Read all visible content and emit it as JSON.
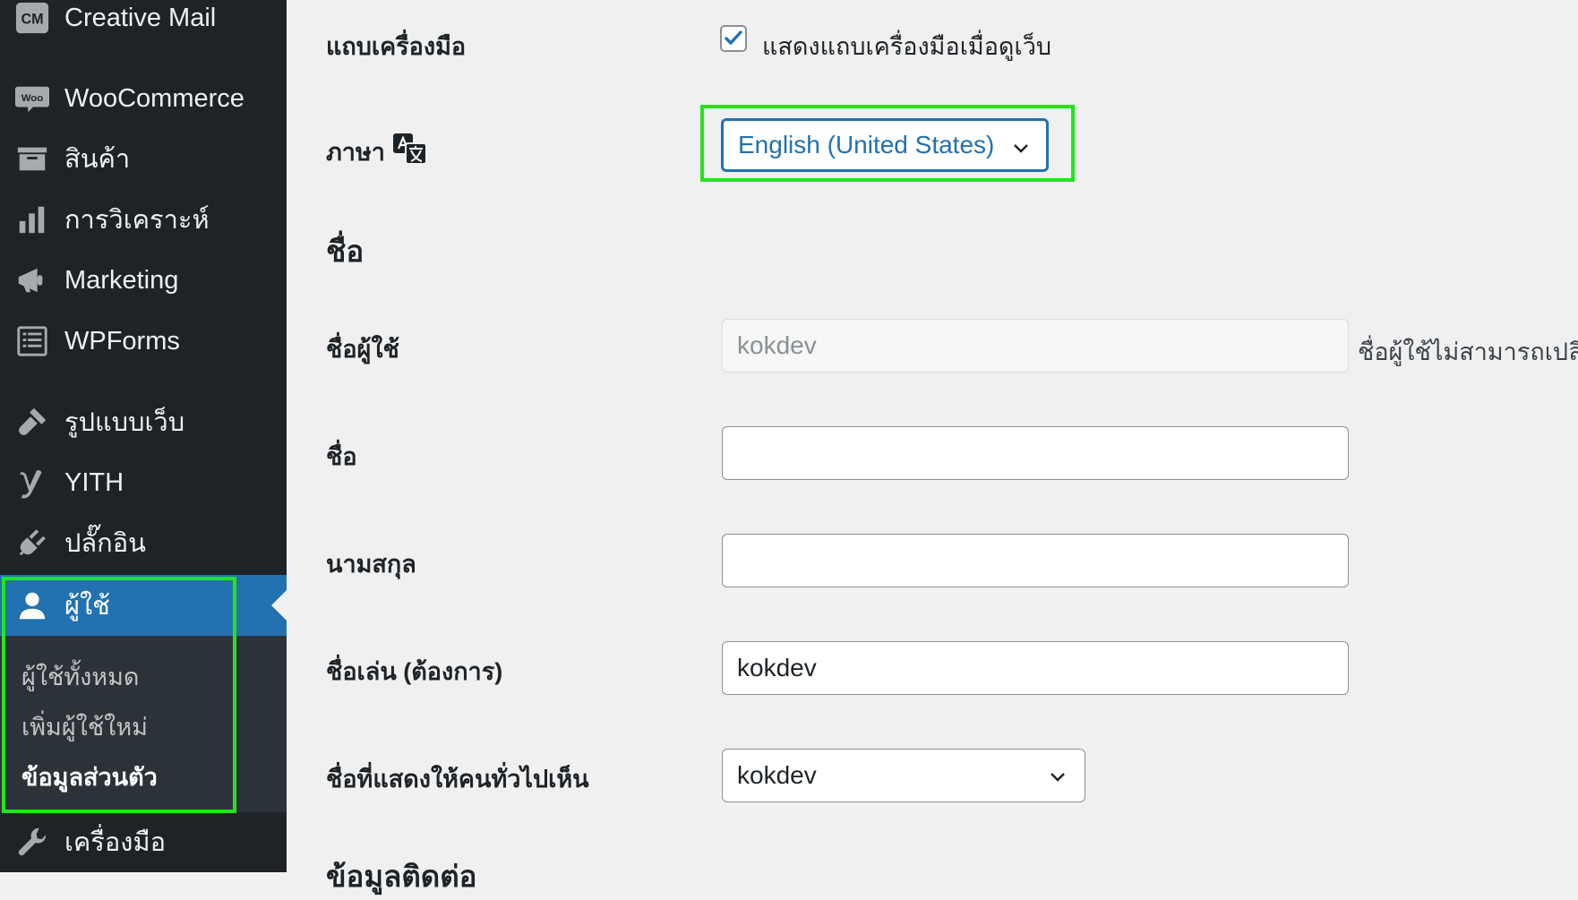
{
  "sidebar": {
    "items": [
      {
        "label": "Creative Mail",
        "icon": "creative-mail-icon"
      },
      {
        "label": "WooCommerce",
        "icon": "woocommerce-icon"
      },
      {
        "label": "สินค้า",
        "icon": "archive-icon"
      },
      {
        "label": "การวิเคราะห์",
        "icon": "bar-chart-icon"
      },
      {
        "label": "Marketing",
        "icon": "megaphone-icon"
      },
      {
        "label": "WPForms",
        "icon": "form-icon"
      },
      {
        "label": "รูปแบบเว็บ",
        "icon": "paintbrush-icon"
      },
      {
        "label": "YITH",
        "icon": "yith-icon"
      },
      {
        "label": "ปลั๊กอิน",
        "icon": "plugin-icon"
      },
      {
        "label": "ผู้ใช้",
        "icon": "user-icon"
      },
      {
        "label": "เครื่องมือ",
        "icon": "wrench-icon"
      }
    ],
    "icon_text": {
      "cm": "CM",
      "woo": "Woo"
    },
    "submenu": [
      {
        "label": "ผู้ใช้ทั้งหมด"
      },
      {
        "label": "เพิ่มผู้ใช้ใหม่"
      },
      {
        "label": "ข้อมูลส่วนตัว"
      }
    ]
  },
  "form": {
    "toolbar_label": "แถบเครื่องมือ",
    "toolbar_checkbox_label": "แสดงแถบเครื่องมือเมื่อดูเว็บ",
    "toolbar_checked": true,
    "language_label": "ภาษา",
    "language_value": "English (United States)",
    "name_section": "ชื่อ",
    "username_label": "ชื่อผู้ใช้",
    "username_value": "kokdev",
    "username_note": "ชื่อผู้ใช้ไม่สามารถเปลี่ย",
    "first_name_label": "ชื่อ",
    "first_name_value": "",
    "last_name_label": "นามสกุล",
    "last_name_value": "",
    "nickname_label": "ชื่อเล่น (ต้องการ)",
    "nickname_value": "kokdev",
    "display_name_label": "ชื่อที่แสดงให้คนทั่วไปเห็น",
    "display_name_value": "kokdev",
    "contact_section": "ข้อมูลติดต่อ"
  },
  "colors": {
    "sidebar_bg": "#1d2327",
    "active_bg": "#2271b1",
    "highlight": "#22e51c",
    "accent": "#2271b1"
  }
}
